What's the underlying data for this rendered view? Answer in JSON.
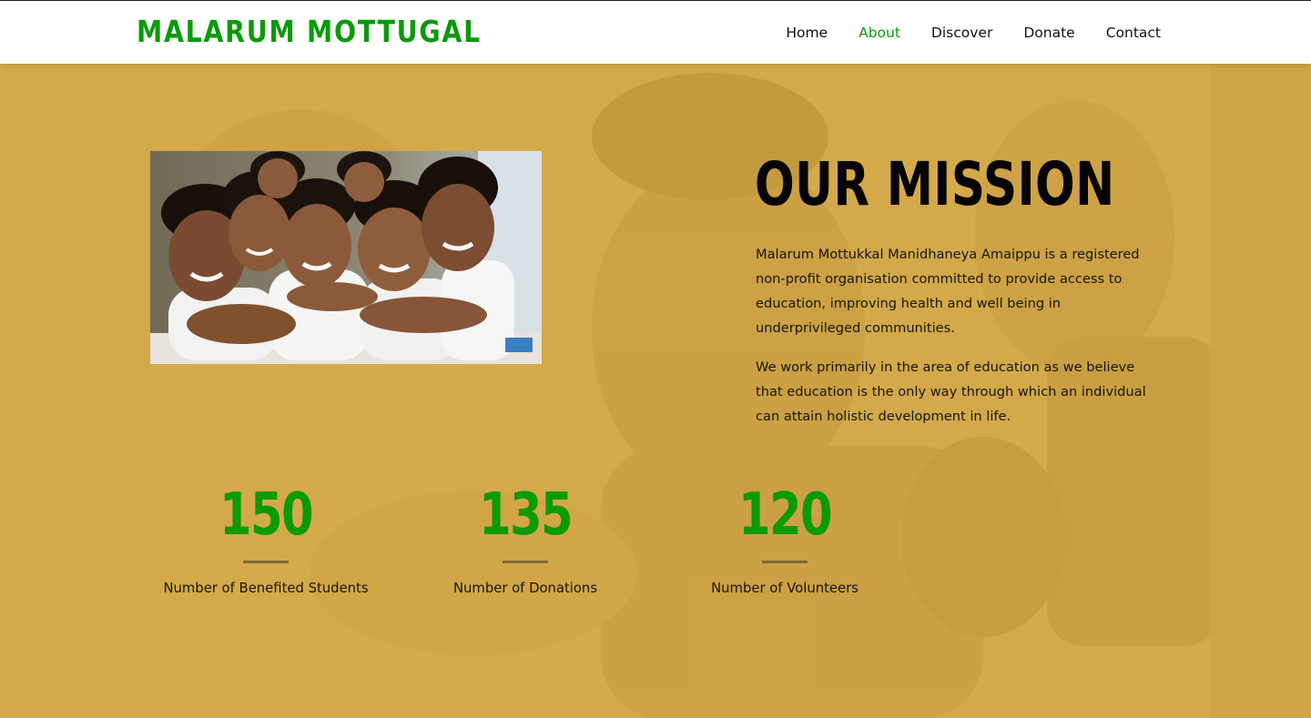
{
  "header": {
    "brand": "MALARUM MOTTUGAL",
    "nav": [
      {
        "label": "Home",
        "active": false
      },
      {
        "label": "About",
        "active": true
      },
      {
        "label": "Discover",
        "active": false
      },
      {
        "label": "Donate",
        "active": false
      },
      {
        "label": "Contact",
        "active": false
      }
    ]
  },
  "mission": {
    "title": "OUR MISSION",
    "paragraphs": [
      "Malarum Mottukkal Manidhaneya Amaippu is a registered non-profit organisation committed to provide access to education, improving health and well being in underprivileged communities.",
      "We work primarily in the area of education as we believe that education is the only way through which an individual can attain holistic development in life."
    ],
    "image_icon": "group-of-smiling-children-photo"
  },
  "stats": [
    {
      "number": "150",
      "label": "Number of Benefited Students"
    },
    {
      "number": "135",
      "label": "Number of Donations"
    },
    {
      "number": "120",
      "label": "Number of Volunteers"
    }
  ],
  "colors": {
    "brand_green": "#0a9a0a",
    "hero_overlay": "#d4a94a",
    "header_bg": "#ffffff",
    "text_dark": "#151515"
  }
}
